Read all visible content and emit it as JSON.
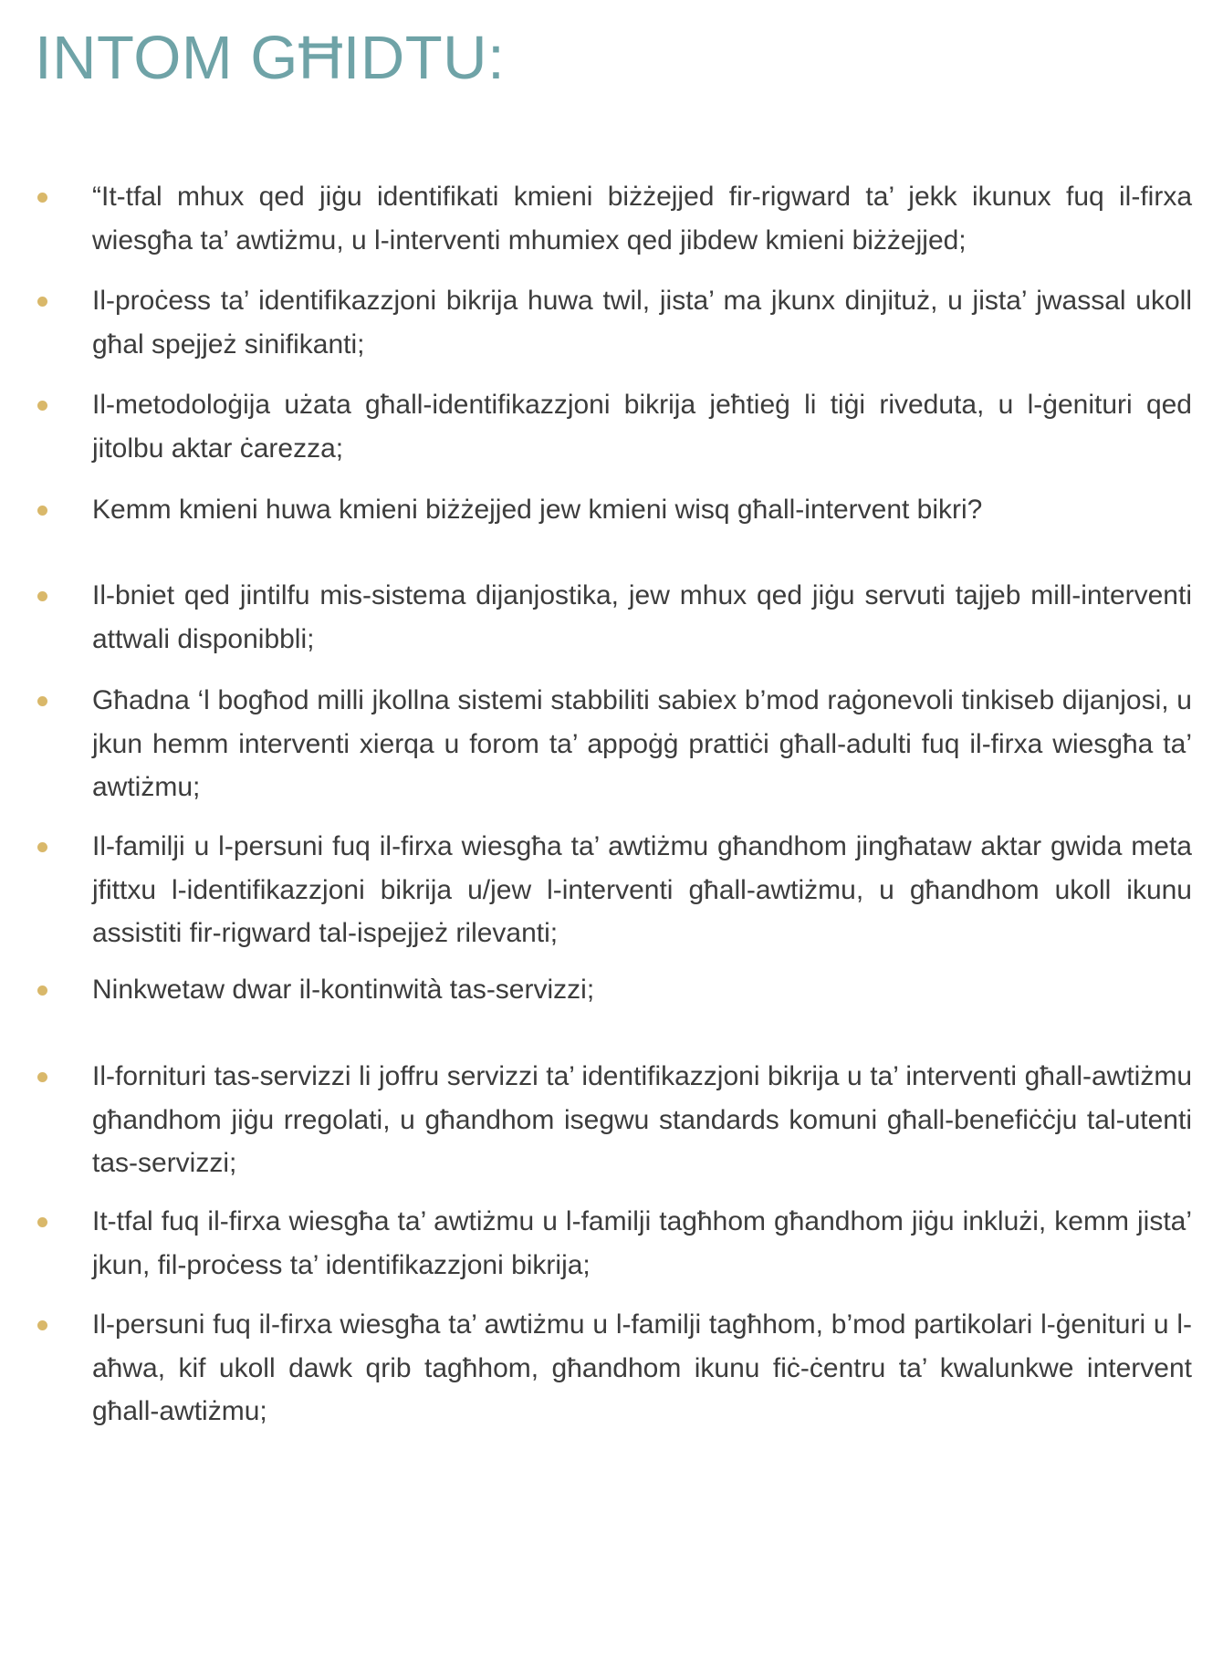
{
  "page": {
    "title": "INTOM GĦIDTU:",
    "bullet_color": "#d9b86a",
    "title_color": "#6fa3a7",
    "bullets": [
      {
        "text": "“It-tfal mhux qed jiġu identifikati kmieni biżżejjed fir-rigward ta’ jekk ikunux fuq il-firxa wiesgħa ta’ awtiżmu, u l-interventi mhumiex qed jibdew kmieni biżżejjed;"
      },
      {
        "text": "Il-proċess ta’ identifikazzjoni bikrija huwa twil, jista’ ma jkunx dinjituż, u jista’ jwassal ukoll għal spejjeż sinifikanti;"
      },
      {
        "text": "Il-metodoloġija użata għall-identifikazzjoni bikrija jeħtieġ li tiġi riveduta, u l-ġenituri qed jitolbu aktar ċarezza;"
      },
      {
        "text": "Kemm kmieni huwa kmieni biżżejjed jew kmieni wisq għall-intervent bikri?"
      },
      {
        "text": "Il-bniet qed jintilfu mis-sistema dijanjostika, jew mhux qed jiġu servuti tajjeb mill-interventi attwali disponibbli;"
      },
      {
        "text": "Għadna ‘l bogħod milli jkollna sistemi stabbiliti sabiex b’mod raġonevoli tinkiseb dijanjosi, u jkun hemm interventi xierqa u forom ta’ appoġġ prattiċi għall-adulti fuq il-firxa wiesgħa ta’ awtiżmu;"
      },
      {
        "text": "Il-familji u l-persuni fuq il-firxa wiesgħa ta’ awtiżmu għandhom jingħataw aktar gwida meta jfittxu l-identifikazzjoni bikrija u/jew l-interventi għall-awtiżmu, u għandhom ukoll ikunu assistiti fir-rigward tal-ispejjeż rilevanti;"
      },
      {
        "text": "Ninkwetaw dwar il-kontinwità tas-servizzi;"
      },
      {
        "text": "Il-fornituri tas-servizzi li joffru servizzi ta’ identifikazzjoni bikrija u ta’ interventi għall-awtiżmu għandhom jiġu rregolati, u għandhom isegwu standards komuni għall-benefiċċju tal-utenti tas-servizzi;"
      },
      {
        "text": "It-tfal fuq il-firxa wiesgħa ta’ awtiżmu u l-familji tagħhom għandhom jiġu inklużi, kemm jista’ jkun, fil-proċess ta’ identifikazzjoni bikrija;"
      },
      {
        "text": "Il-persuni fuq il-firxa wiesgħa ta’ awtiżmu u l-familji tagħhom, b’mod partikolari l-ġenituri u l-aħwa, kif ukoll dawk qrib tagħhom, għandhom ikunu fiċ-ċentru ta’ kwalunkwe intervent għall-awtiżmu;"
      }
    ]
  }
}
